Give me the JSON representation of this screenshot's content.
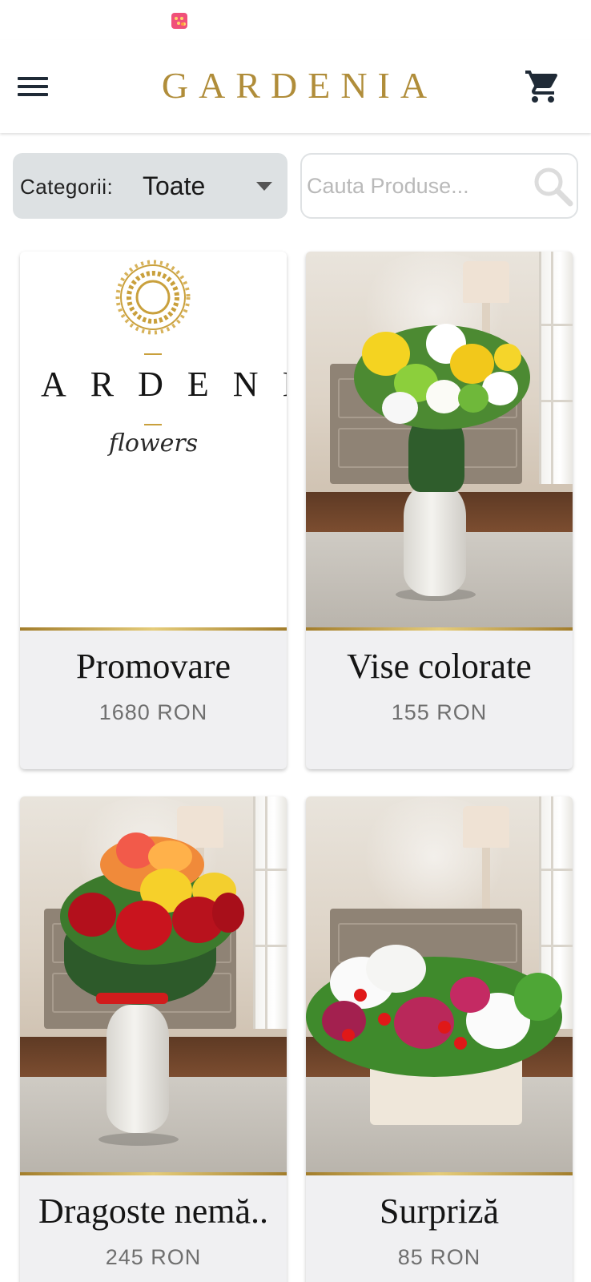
{
  "app": {
    "brand": "GARDENIA"
  },
  "filters": {
    "category_label": "Categorii:",
    "category_value": "Toate",
    "search_placeholder": "Cauta Produse..."
  },
  "products": [
    {
      "title": "Promovare",
      "price": "1680 RON",
      "logo_word": "ARDENI",
      "logo_script": "flowers"
    },
    {
      "title": "Vise colorate",
      "price": "155 RON"
    },
    {
      "title": "Dragoste nemă..",
      "price": "245 RON"
    },
    {
      "title": "Surpriză",
      "price": "85 RON"
    }
  ],
  "colors": {
    "brand_gold": "#b08d3a",
    "category_bg": "#dde1e3",
    "card_bg": "#f0f0f2",
    "icon_dark": "#1f2a36"
  },
  "icons": {
    "menu": "hamburger-icon",
    "cart": "cart-icon",
    "search": "search-icon",
    "dropdown": "dropdown-arrow-icon",
    "notification": "app-notification-icon"
  }
}
